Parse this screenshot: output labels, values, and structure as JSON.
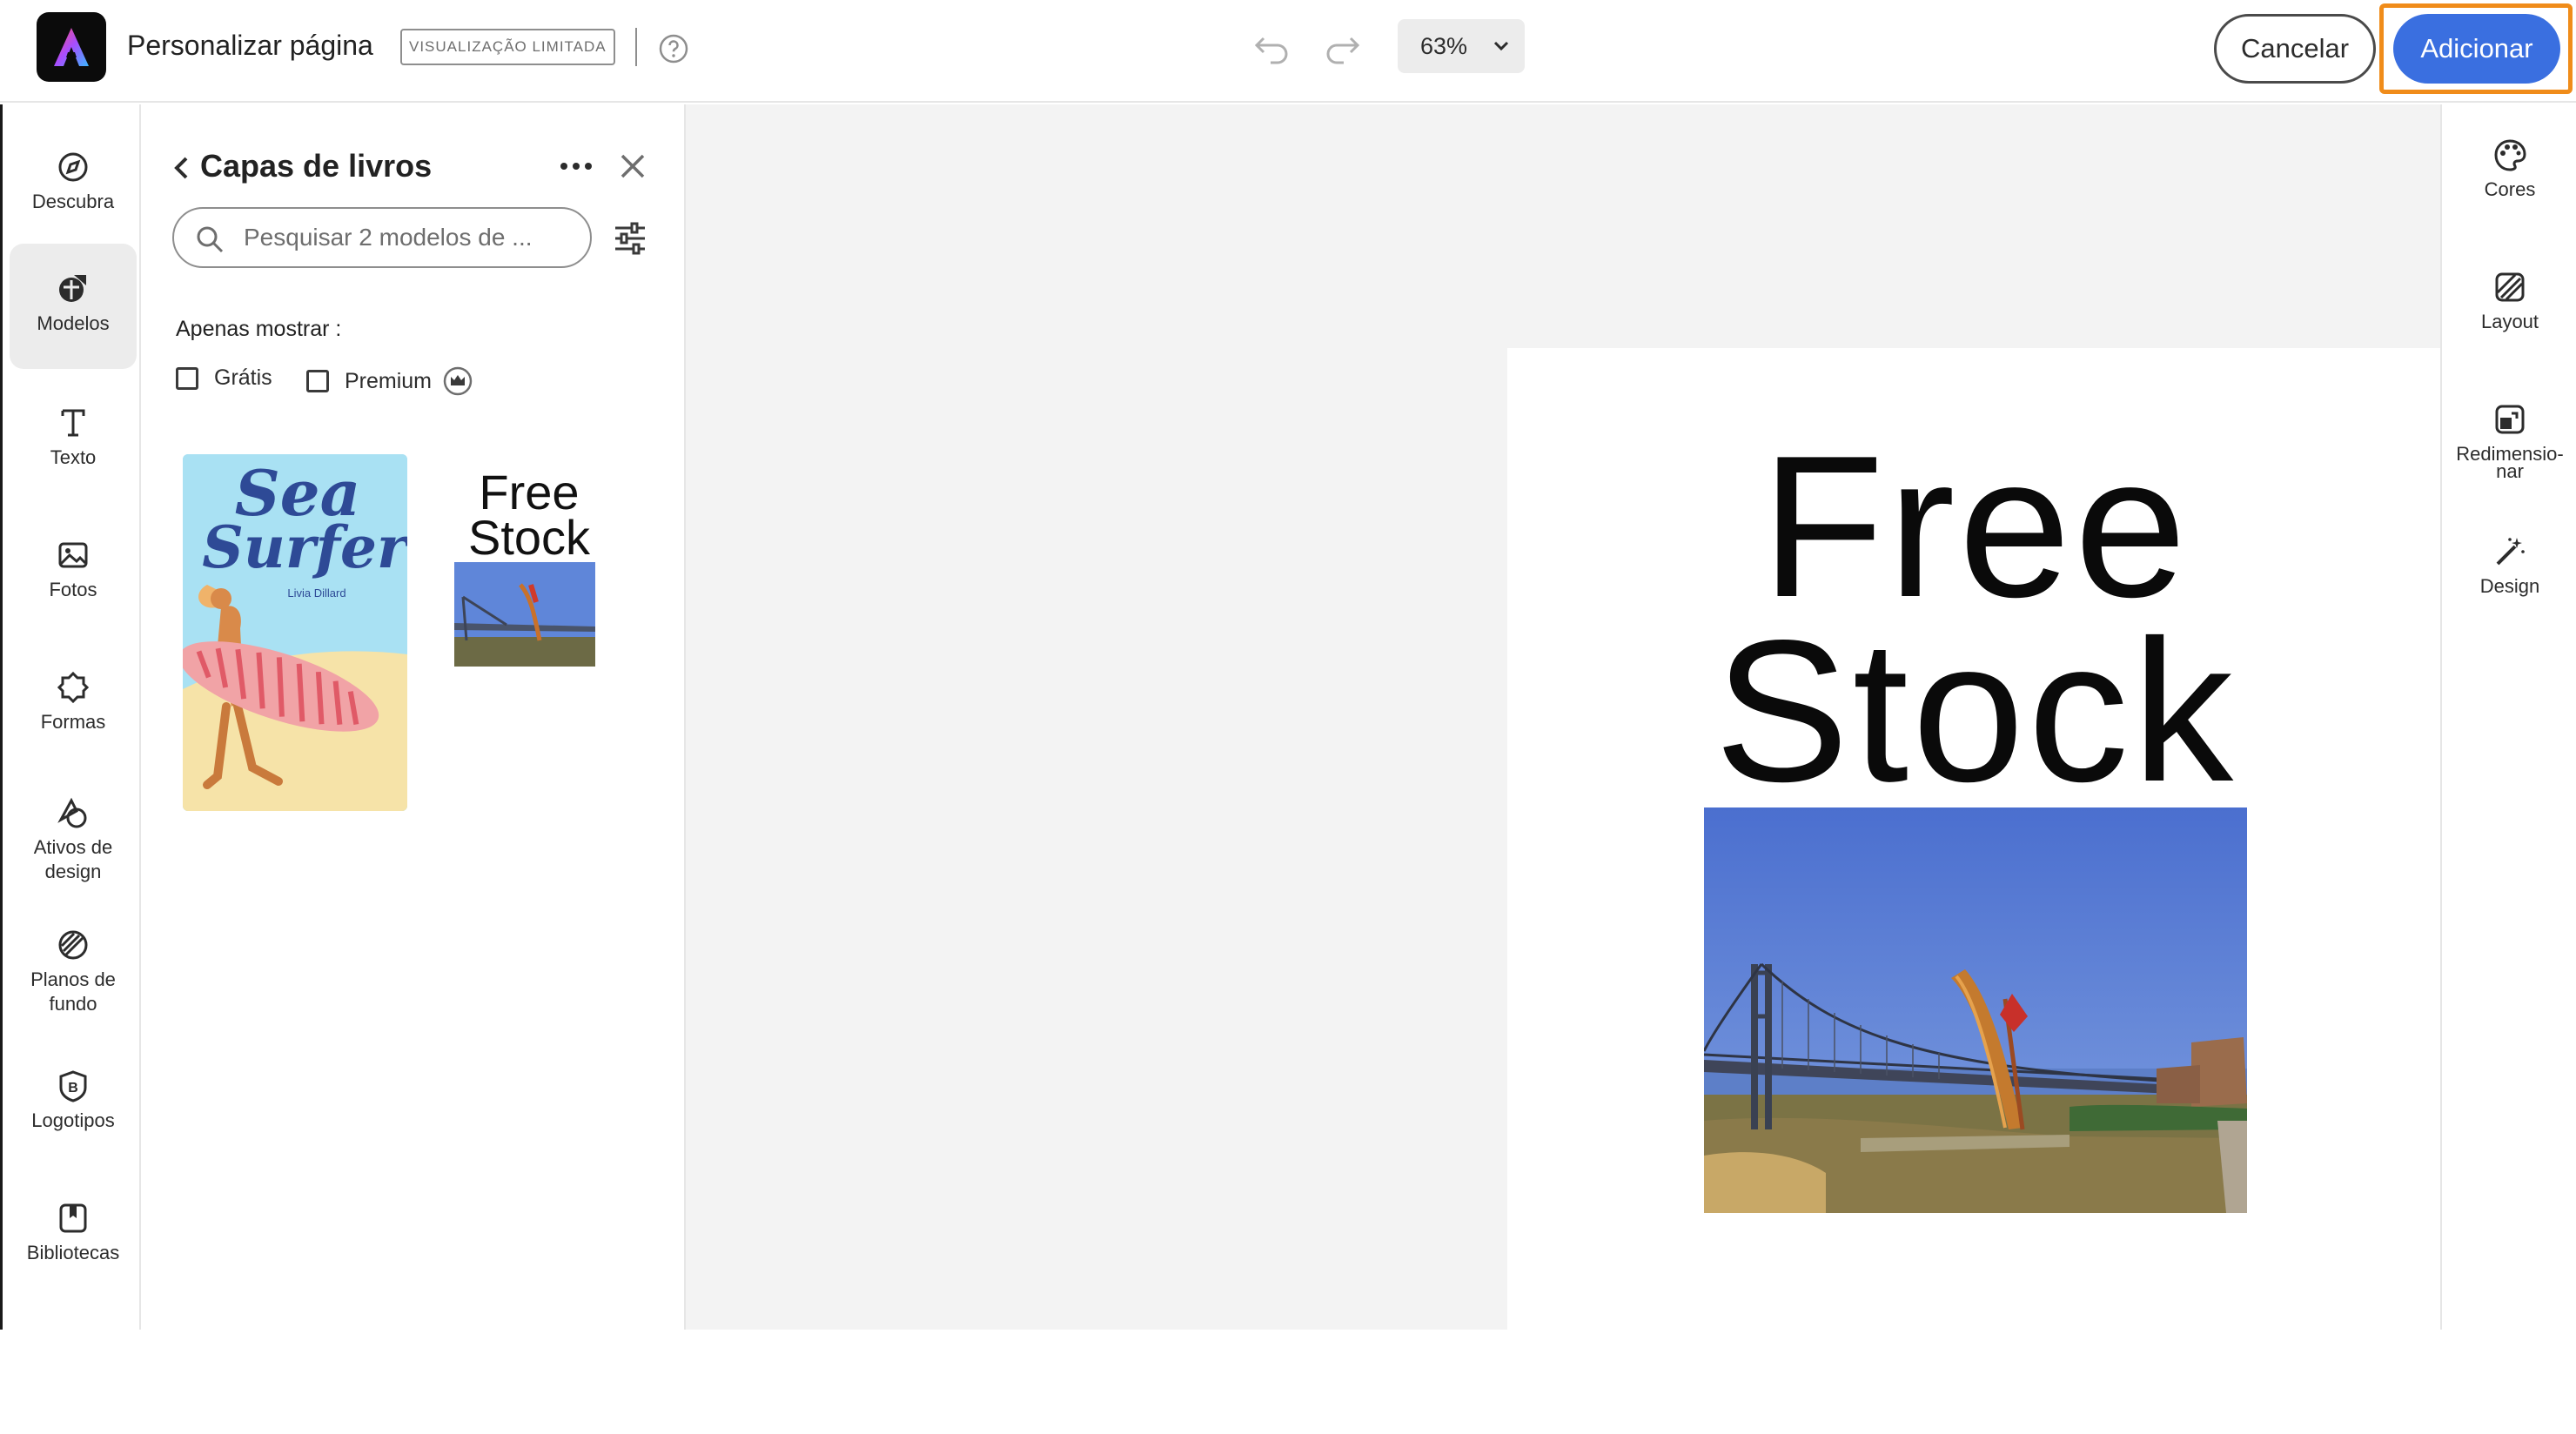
{
  "header": {
    "title": "Personalizar página",
    "badge": "VISUALIZAÇÃO LIMITADA",
    "zoom": "63%",
    "cancel_label": "Cancelar",
    "add_label": "Adicionar"
  },
  "left_rail": {
    "items": [
      {
        "label": "Descubra",
        "icon": "compass-icon"
      },
      {
        "label": "Modelos",
        "icon": "templates-icon",
        "active": true
      },
      {
        "label": "Texto",
        "icon": "text-icon"
      },
      {
        "label": "Fotos",
        "icon": "photo-icon"
      },
      {
        "label": "Formas",
        "icon": "shapes-icon"
      },
      {
        "label": "Ativos de design",
        "icon": "design-assets-icon"
      },
      {
        "label": "Planos de fundo",
        "icon": "backgrounds-icon"
      },
      {
        "label": "Logotipos",
        "icon": "logo-icon"
      },
      {
        "label": "Bibliotecas",
        "icon": "libraries-icon"
      }
    ]
  },
  "panel": {
    "title": "Capas de livros",
    "search_placeholder": "Pesquisar 2 modelos de ...",
    "show_only_label": "Apenas mostrar :",
    "filter_free": "Grátis",
    "filter_premium": "Premium",
    "templates": [
      {
        "title_line1": "Sea",
        "title_line2": "Surfer",
        "author": "Livia Dillard"
      },
      {
        "title_line1": "Free",
        "title_line2": "Stock"
      }
    ]
  },
  "canvas": {
    "line1": "Free",
    "line2": "Stock"
  },
  "right_rail": {
    "items": [
      {
        "label": "Cores",
        "icon": "palette-icon"
      },
      {
        "label": "Layout",
        "icon": "layout-icon"
      },
      {
        "label": "Redimensio-nar",
        "icon": "resize-icon"
      },
      {
        "label": "Design",
        "icon": "magic-wand-icon"
      }
    ]
  },
  "colors": {
    "accent": "#3a6fe0",
    "highlight": "#f08c1a"
  }
}
